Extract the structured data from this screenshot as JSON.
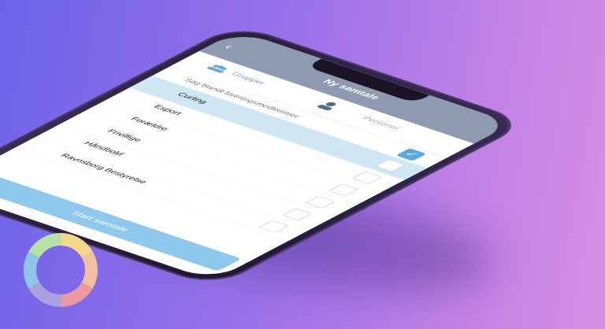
{
  "header": {
    "title": "Ny samtale"
  },
  "tabs": [
    {
      "label": "Grupper"
    },
    {
      "label": "Personer"
    }
  ],
  "search": {
    "placeholder": "Søg blandt foreningsmedlemmer"
  },
  "list": {
    "items": [
      {
        "label": "Curling",
        "selected": true
      },
      {
        "label": "Esport",
        "selected": false
      },
      {
        "label": "Forældre",
        "selected": false
      },
      {
        "label": "Frivillige",
        "selected": false
      },
      {
        "label": "Håndbold",
        "selected": false
      },
      {
        "label": "Ravnsborg Bestyrelse",
        "selected": false
      }
    ]
  },
  "start_button": {
    "label": "Start samtale"
  },
  "colors": {
    "header": "#8d9ab0",
    "accent": "#5aa8dc",
    "button": "#8ec8ec",
    "selected_row": "#cfe6f5"
  },
  "icons": [
    "back-icon",
    "group-icon",
    "person-icon",
    "checkmark-icon",
    "chat-icon",
    "app-logo-icon"
  ]
}
